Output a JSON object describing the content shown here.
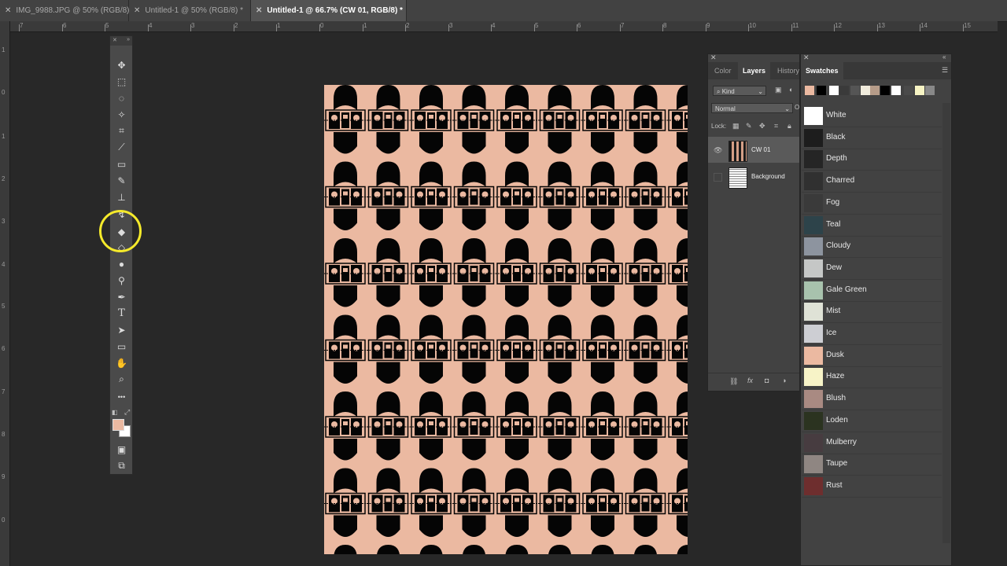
{
  "tabs": [
    {
      "label": "IMG_9988.JPG @ 50% (RGB/8)",
      "active": false
    },
    {
      "label": "Untitled-1 @ 50% (RGB/8) *",
      "active": false
    },
    {
      "label": "Untitled-1 @ 66.7% (CW 01, RGB/8) *",
      "active": true
    }
  ],
  "ruler": {
    "h": [
      "7",
      "6",
      "5",
      "4",
      "3",
      "2",
      "1",
      "0",
      "1",
      "2",
      "3",
      "4",
      "5",
      "6",
      "7",
      "8",
      "9",
      "10",
      "11",
      "12",
      "13",
      "14",
      "15"
    ],
    "v": [
      "1",
      "0",
      "1",
      "2",
      "3",
      "4",
      "5",
      "6",
      "7",
      "8",
      "9",
      "0"
    ]
  },
  "colors": {
    "foreground": "#ebb9a1",
    "background": "#ffffff",
    "canvas": "#ebb9a1"
  },
  "tools": [
    "move-icon",
    "marquee-icon",
    "lasso-icon",
    "magic-wand-icon",
    "crop-icon",
    "eyedropper-icon",
    "healing-brush-icon",
    "brush-icon",
    "clone-stamp-icon",
    "history-brush-icon",
    "eraser-icon",
    "paint-bucket-icon",
    "blur-icon",
    "dodge-icon",
    "pen-icon",
    "type-icon",
    "path-selection-icon",
    "rectangle-icon",
    "hand-icon",
    "zoom-icon",
    "more-tools-icon",
    "quick-mask-icon",
    "screen-mode-icon"
  ],
  "layers_panel": {
    "tabs": [
      "Color",
      "Layers",
      "History"
    ],
    "filter_kind": "Kind",
    "blend_mode": "Normal",
    "opacity_label": "O",
    "lock_label": "Lock:",
    "layers": [
      {
        "name": "CW 01",
        "visible": true,
        "selected": true
      },
      {
        "name": "Background",
        "visible": false,
        "selected": false
      }
    ],
    "footer_icons": [
      "link-icon",
      "fx-icon",
      "mask-icon",
      "adjustment-icon"
    ],
    "fx_label": "fx"
  },
  "swatches_panel": {
    "title": "Swatches",
    "recent": [
      "#ebb9a1",
      "#000000",
      "#ffffff",
      "#3a3a3a",
      "#555555",
      "#f0ebdc",
      "#b69c89",
      "#000000",
      "#ffffff",
      "#4a4a4a",
      "#f7f4c4",
      "#888888"
    ],
    "swatches": [
      {
        "name": "White",
        "color": "#ffffff"
      },
      {
        "name": "Black",
        "color": "#1d1d1d"
      },
      {
        "name": "Depth",
        "color": "#252525"
      },
      {
        "name": "Charred",
        "color": "#303030"
      },
      {
        "name": "Fog",
        "color": "#3a3a3a"
      },
      {
        "name": "Teal",
        "color": "#2d434a"
      },
      {
        "name": "Cloudy",
        "color": "#8d949f"
      },
      {
        "name": "Dew",
        "color": "#c5c7c6"
      },
      {
        "name": "Gale Green",
        "color": "#a8c2ad"
      },
      {
        "name": "Mist",
        "color": "#dfe2d6"
      },
      {
        "name": "Ice",
        "color": "#cdced3"
      },
      {
        "name": "Dusk",
        "color": "#ebb9a1"
      },
      {
        "name": "Haze",
        "color": "#f7f3c7"
      },
      {
        "name": "Blush",
        "color": "#a98a82"
      },
      {
        "name": "Loden",
        "color": "#2b3320"
      },
      {
        "name": "Mulberry",
        "color": "#473c40"
      },
      {
        "name": "Taupe",
        "color": "#8f8682"
      },
      {
        "name": "Rust",
        "color": "#6e2e2e"
      }
    ]
  }
}
